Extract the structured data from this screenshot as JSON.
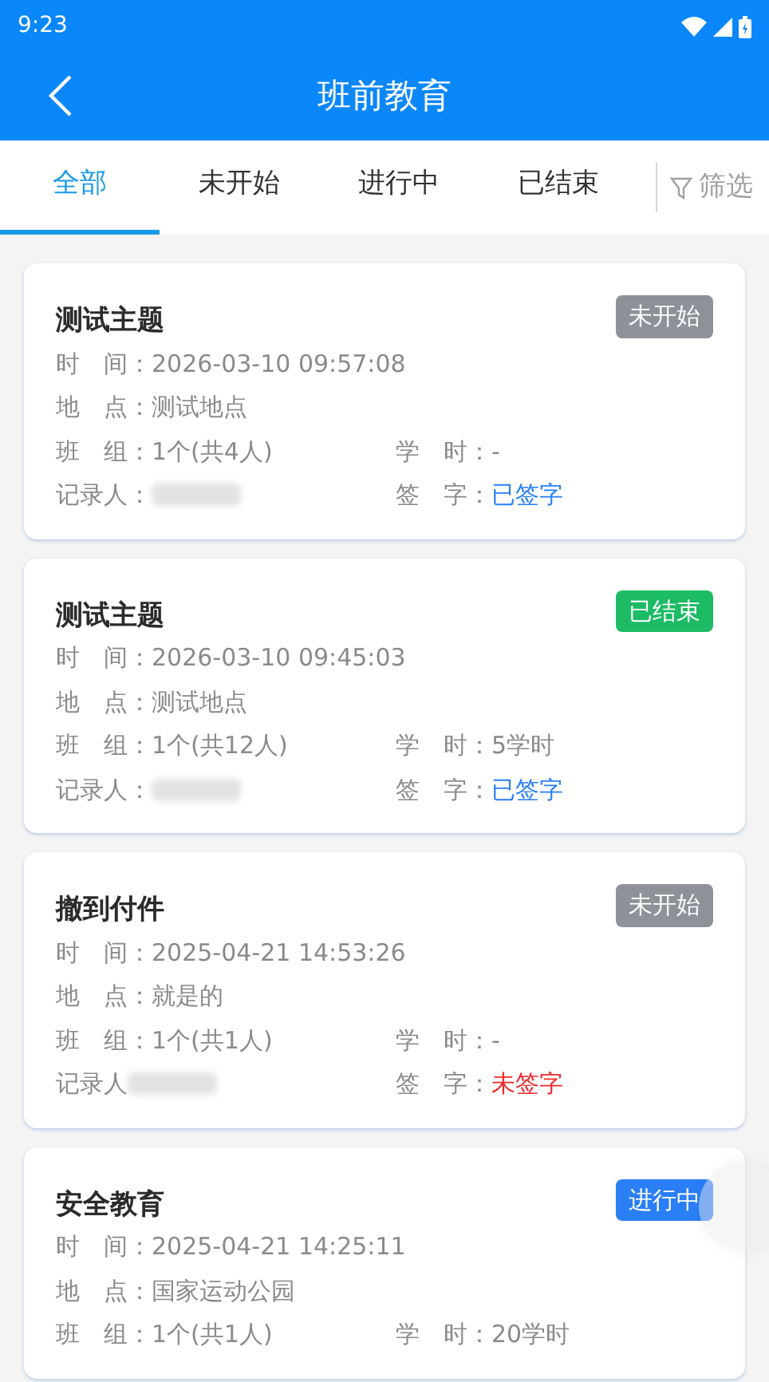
{
  "status_bar": {
    "time": "9:23"
  },
  "header": {
    "title": "班前教育"
  },
  "tabs": [
    {
      "label": "全部",
      "selected": true
    },
    {
      "label": "未开始",
      "selected": false
    },
    {
      "label": "进行中",
      "selected": false
    },
    {
      "label": "已结束",
      "selected": false
    }
  ],
  "filter": {
    "label": "筛选"
  },
  "records": [
    {
      "title": "测试主题",
      "status": {
        "label": "未开始",
        "kind": "not_started"
      },
      "time_label": "时　间：",
      "time": "2026-03-10 09:57:08",
      "place_label": "地　点：",
      "place": "测试地点",
      "team_label": "班　组：",
      "team": "1个(共4人)",
      "hours_label": "学　时：",
      "hours": "-",
      "recorder_label": "记录人：",
      "sign_label": "签　字：",
      "sign": "已签字",
      "signed": true
    },
    {
      "title": "测试主题",
      "status": {
        "label": "已结束",
        "kind": "ended"
      },
      "time_label": "时　间：",
      "time": "2026-03-10 09:45:03",
      "place_label": "地　点：",
      "place": "测试地点",
      "team_label": "班　组：",
      "team": "1个(共12人)",
      "hours_label": "学　时：",
      "hours": "5学时",
      "recorder_label": "记录人：",
      "sign_label": "签　字：",
      "sign": "已签字",
      "signed": true
    },
    {
      "title": "撤到付件",
      "status": {
        "label": "未开始",
        "kind": "not_started"
      },
      "time_label": "时　间：",
      "time": "2025-04-21 14:53:26",
      "place_label": "地　点：",
      "place": "就是的",
      "team_label": "班　组：",
      "team": "1个(共1人)",
      "hours_label": "学　时：",
      "hours": "-",
      "recorder_label": "记录人",
      "sign_label": "签　字：",
      "sign": "未签字",
      "signed": false
    },
    {
      "title": "安全教育",
      "status": {
        "label": "进行中",
        "kind": "in_progress"
      },
      "time_label": "时　间：",
      "time": "2025-04-21 14:25:11",
      "place_label": "地　点：",
      "place": "国家运动公园",
      "team_label": "班　组：",
      "team": "1个(共1人)",
      "hours_label": "学　时：",
      "hours": "20学时"
    }
  ]
}
